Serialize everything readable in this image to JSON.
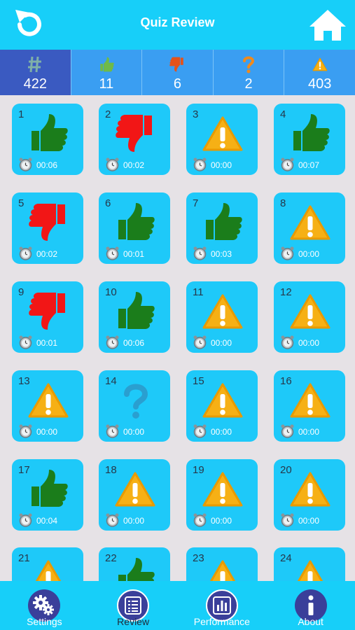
{
  "header": {
    "title": "Quiz Review"
  },
  "stats": [
    {
      "icon": "hash-icon",
      "value": "422"
    },
    {
      "icon": "thumbs-up-icon",
      "value": "11"
    },
    {
      "icon": "thumbs-down-icon",
      "value": "6"
    },
    {
      "icon": "question-icon",
      "value": "2"
    },
    {
      "icon": "warning-icon",
      "value": "403"
    }
  ],
  "questions": [
    {
      "number": "1",
      "result": "correct",
      "time": "00:06"
    },
    {
      "number": "2",
      "result": "wrong",
      "time": "00:02"
    },
    {
      "number": "3",
      "result": "unanswered",
      "time": "00:00"
    },
    {
      "number": "4",
      "result": "correct",
      "time": "00:07"
    },
    {
      "number": "5",
      "result": "wrong",
      "time": "00:02"
    },
    {
      "number": "6",
      "result": "correct",
      "time": "00:01"
    },
    {
      "number": "7",
      "result": "correct",
      "time": "00:03"
    },
    {
      "number": "8",
      "result": "unanswered",
      "time": "00:00"
    },
    {
      "number": "9",
      "result": "wrong",
      "time": "00:01"
    },
    {
      "number": "10",
      "result": "correct",
      "time": "00:06"
    },
    {
      "number": "11",
      "result": "unanswered",
      "time": "00:00"
    },
    {
      "number": "12",
      "result": "unanswered",
      "time": "00:00"
    },
    {
      "number": "13",
      "result": "unanswered",
      "time": "00:00"
    },
    {
      "number": "14",
      "result": "unsure",
      "time": "00:00"
    },
    {
      "number": "15",
      "result": "unanswered",
      "time": "00:00"
    },
    {
      "number": "16",
      "result": "unanswered",
      "time": "00:00"
    },
    {
      "number": "17",
      "result": "correct",
      "time": "00:04"
    },
    {
      "number": "18",
      "result": "unanswered",
      "time": "00:00"
    },
    {
      "number": "19",
      "result": "unanswered",
      "time": "00:00"
    },
    {
      "number": "20",
      "result": "unanswered",
      "time": "00:00"
    },
    {
      "number": "21",
      "result": "unanswered",
      "time": ""
    },
    {
      "number": "22",
      "result": "correct",
      "time": ""
    },
    {
      "number": "23",
      "result": "unanswered",
      "time": ""
    },
    {
      "number": "24",
      "result": "unanswered",
      "time": ""
    }
  ],
  "tabs": [
    {
      "label": "Settings",
      "icon": "gears-icon",
      "active": false
    },
    {
      "label": "Review",
      "icon": "list-icon",
      "active": true
    },
    {
      "label": "Performance",
      "icon": "bar-chart-icon",
      "active": false
    },
    {
      "label": "About",
      "icon": "info-icon",
      "active": false
    }
  ],
  "colors": {
    "header": "#17cff9",
    "tile": "#1ec9f9",
    "correct": "#1b7d1b",
    "wrong": "#f21616",
    "warning": "#f6b015",
    "tab_circle": "#3a3f9a"
  }
}
